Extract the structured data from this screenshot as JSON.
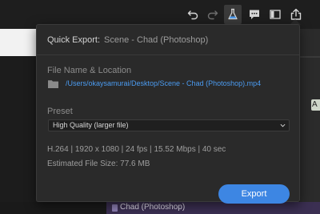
{
  "toolbar": {
    "icons": [
      "undo-icon",
      "redo-icon",
      "flask-icon",
      "comment-icon",
      "panel-icon",
      "share-icon"
    ],
    "accent_color": "#4b9bf0"
  },
  "background": {
    "bottom_clip_label": "Chad (Photoshop)",
    "right_tab_text": "A"
  },
  "quick_export": {
    "label": "Quick Export:",
    "sequence": "Scene - Chad (Photoshop)",
    "file_section_label": "File Name & Location",
    "file_path": "/Users/okaysamurai/Desktop/Scene - Chad (Photoshop).mp4",
    "preset_section_label": "Preset",
    "preset_value": "High Quality (larger file)",
    "specs": "H.264 | 1920 x 1080 | 24 fps | 15.52 Mbps | 40 sec",
    "file_size": "Estimated File Size: 77.6 MB",
    "export_label": "Export",
    "export_color": "#3d86e3"
  }
}
